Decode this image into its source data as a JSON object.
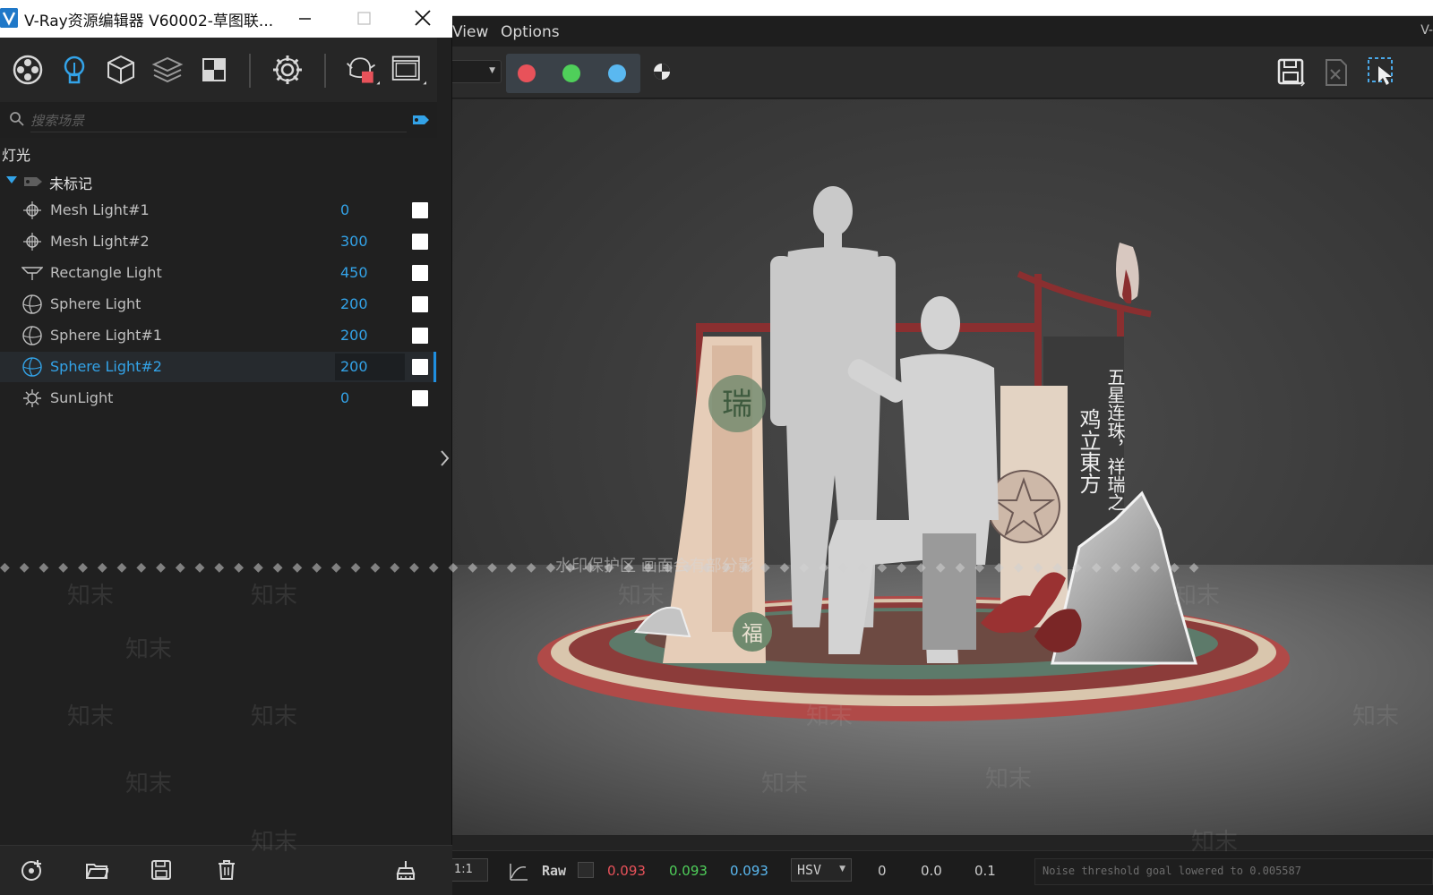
{
  "asset_editor": {
    "title": "V-Ray资源编辑器 V60002-草图联...",
    "search_placeholder": "搜索场景",
    "section_title": "灯光",
    "group_label": "未标记",
    "lights": [
      {
        "name": "Mesh Light#1",
        "value": "0",
        "icon": "mesh-light-icon",
        "selected": false
      },
      {
        "name": "Mesh Light#2",
        "value": "300",
        "icon": "mesh-light-icon",
        "selected": false
      },
      {
        "name": "Rectangle Light",
        "value": "450",
        "icon": "rectangle-light-icon",
        "selected": false
      },
      {
        "name": "Sphere Light",
        "value": "200",
        "icon": "sphere-light-icon",
        "selected": false
      },
      {
        "name": "Sphere Light#1",
        "value": "200",
        "icon": "sphere-light-icon",
        "selected": false
      },
      {
        "name": "Sphere Light#2",
        "value": "200",
        "icon": "sphere-light-icon",
        "selected": true
      },
      {
        "name": "SunLight",
        "value": "0",
        "icon": "sun-light-icon",
        "selected": false
      }
    ],
    "toolbar_icons": [
      "materials-icon",
      "lights-icon",
      "geometry-icon",
      "layers-icon",
      "textures-icon",
      "settings-icon",
      "render-teapot-icon",
      "frame-buffer-icon"
    ],
    "bottom_icons": [
      "add-asset-icon",
      "open-folder-icon",
      "save-icon",
      "delete-icon",
      "purge-icon"
    ]
  },
  "frame_buffer": {
    "menu": [
      "View",
      "Options"
    ],
    "corner_text": "V-",
    "channel_colors": [
      "#e8525a",
      "#4fcf5a",
      "#5ab8f0"
    ],
    "status": {
      "zoom": "1:1",
      "color_space": "Raw",
      "r": "0.093",
      "g": "0.093",
      "b": "0.093",
      "color_mode": "HSV",
      "h": "0",
      "s": "0.0",
      "v": "0.1",
      "message": "Noise threshold goal lowered to 0.005587"
    },
    "viewport": {
      "watermark_protect": "水印保护区  画面会有部分影",
      "watermark_text": "知末",
      "banner_vertical_1": "五星连珠，祥瑞之",
      "banner_vertical_2": "鸡立東方",
      "scroll_char_left": "瑞",
      "scroll_char_bottom": "福"
    }
  }
}
